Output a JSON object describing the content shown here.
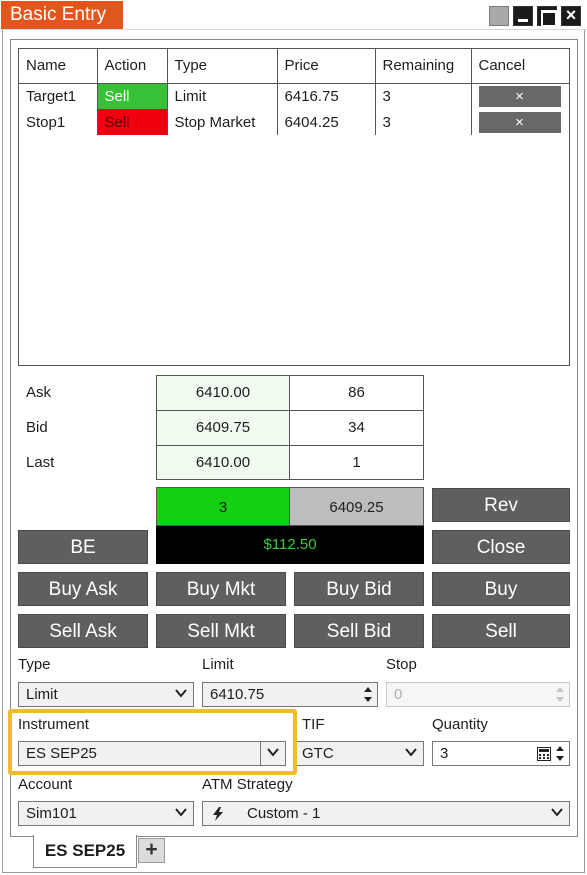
{
  "window": {
    "title": "Basic Entry"
  },
  "orders": {
    "columns": [
      "Name",
      "Action",
      "Type",
      "Price",
      "Remaining",
      "Cancel"
    ],
    "rows": [
      {
        "name": "Target1",
        "action": "Sell",
        "type": "Limit",
        "price": "6416.75",
        "remaining": "3",
        "cancel": "×"
      },
      {
        "name": "Stop1",
        "action": "Sell",
        "type": "Stop Market",
        "price": "6404.25",
        "remaining": "3",
        "cancel": "×"
      }
    ]
  },
  "quotes": {
    "ask": {
      "label": "Ask",
      "price": "6410.00",
      "size": "86"
    },
    "bid": {
      "label": "Bid",
      "price": "6409.75",
      "size": "34"
    },
    "last": {
      "label": "Last",
      "price": "6410.00",
      "size": "1"
    }
  },
  "position": {
    "quantity": "3",
    "avg_price": "6409.25",
    "pnl": "$112.50"
  },
  "buttons": {
    "rev": "Rev",
    "be": "BE",
    "close": "Close",
    "buy_ask": "Buy Ask",
    "buy_mkt": "Buy Mkt",
    "buy_bid": "Buy Bid",
    "buy": "Buy",
    "sell_ask": "Sell Ask",
    "sell_mkt": "Sell Mkt",
    "sell_bid": "Sell Bid",
    "sell": "Sell"
  },
  "form": {
    "type": {
      "label": "Type",
      "value": "Limit"
    },
    "limit": {
      "label": "Limit",
      "value": "6410.75"
    },
    "stop": {
      "label": "Stop",
      "value": "0"
    },
    "instrument": {
      "label": "Instrument",
      "value": "ES SEP25"
    },
    "tif": {
      "label": "TIF",
      "value": "GTC"
    },
    "quantity": {
      "label": "Quantity",
      "value": "3"
    },
    "account": {
      "label": "Account",
      "value": "Sim101"
    },
    "atm": {
      "label": "ATM Strategy",
      "value": "Custom - 1",
      "icon": "lightning-icon"
    }
  },
  "tabs": {
    "active": "ES SEP25",
    "add": "+"
  },
  "colors": {
    "title_accent": "#e2561e",
    "sell_green": "#36c136",
    "sell_red": "#f0000f",
    "button_gray": "#5f5f5f",
    "pnl_text": "#3cc93c",
    "highlight": "#f5b830"
  }
}
